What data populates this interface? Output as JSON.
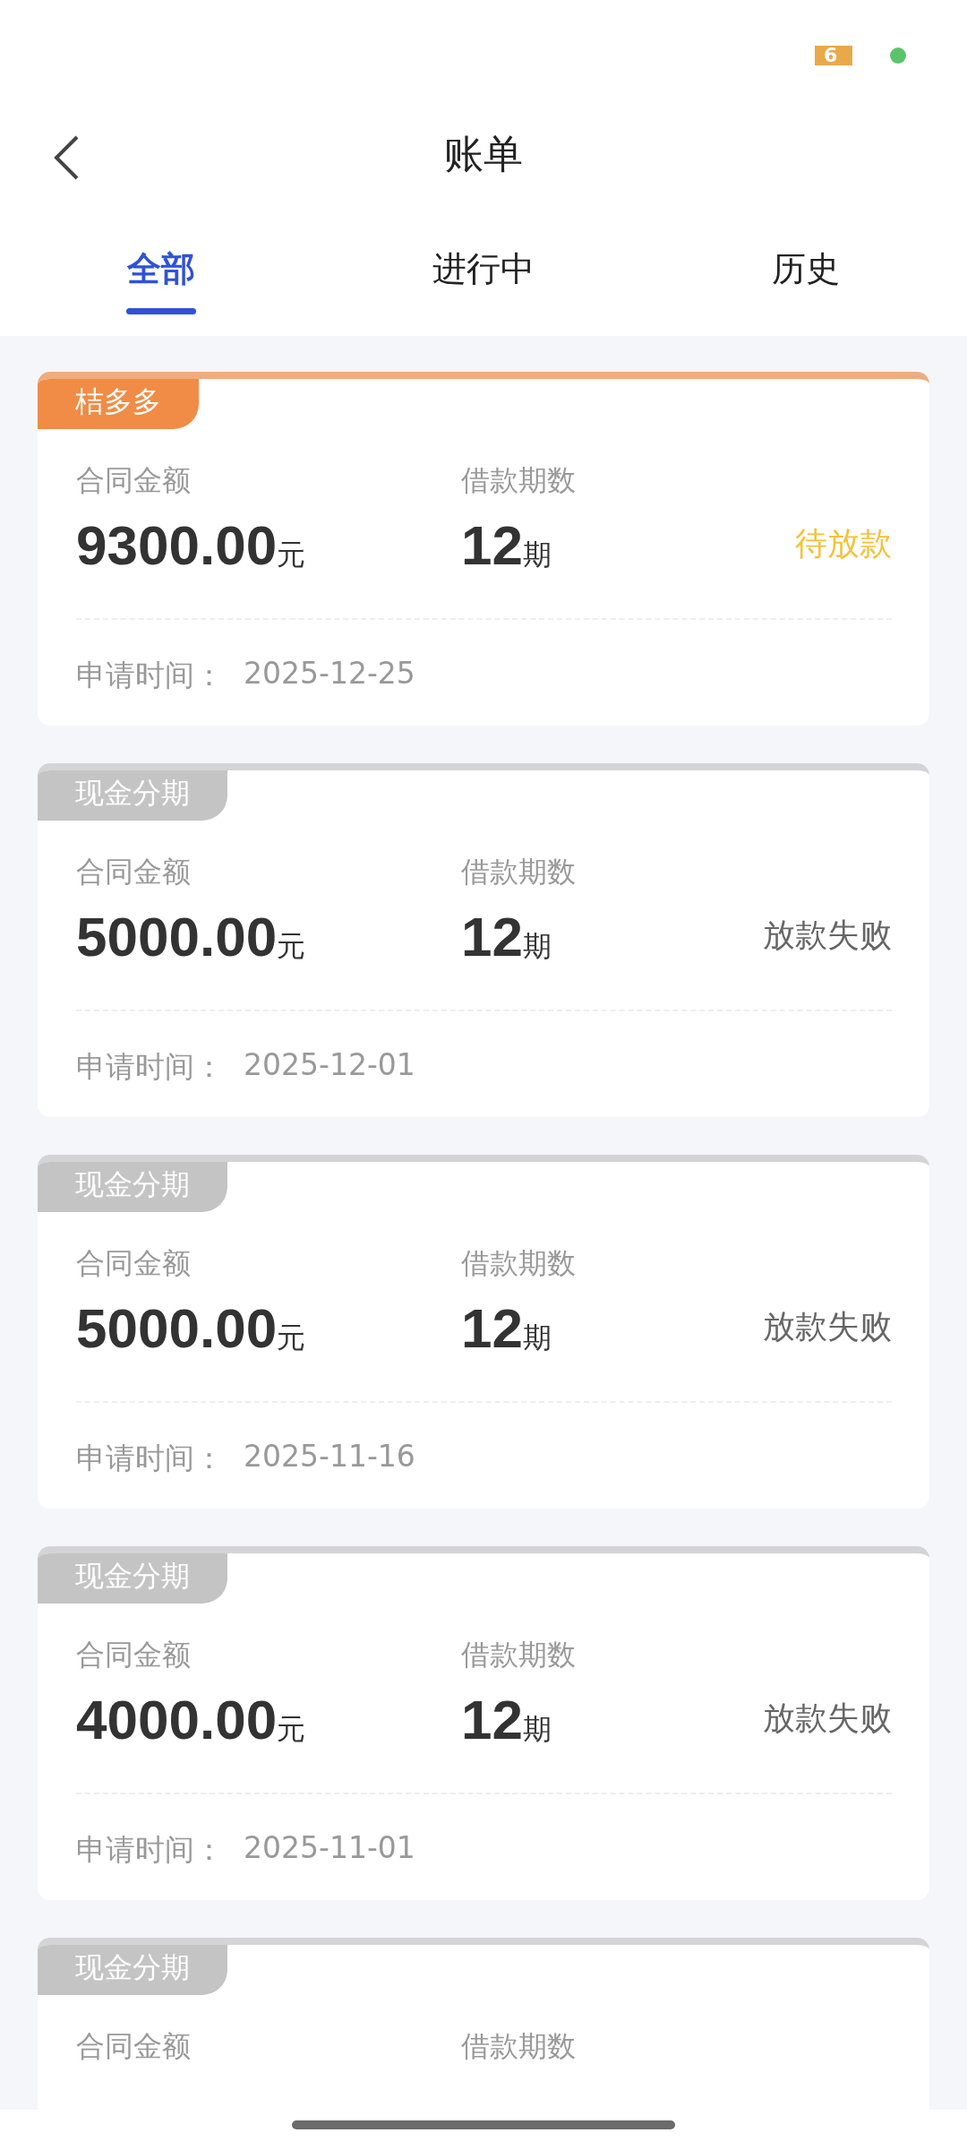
{
  "status_bar": {
    "battery": "6"
  },
  "header": {
    "title": "账单"
  },
  "tabs": [
    {
      "label": "全部",
      "selected": true
    },
    {
      "label": "进行中",
      "selected": false
    },
    {
      "label": "历史",
      "selected": false
    }
  ],
  "bills": [
    {
      "tag": "桔多多",
      "kind": "pending",
      "amount_label": "合同金额",
      "amount": "9300.00",
      "amount_unit": "元",
      "term_label": "借款期数",
      "term": "12",
      "term_unit": "期",
      "status": "待放款",
      "date_label": "申请时间：",
      "date": "2025-12-25"
    },
    {
      "tag": "现金分期",
      "kind": "failed",
      "amount_label": "合同金额",
      "amount": "5000.00",
      "amount_unit": "元",
      "term_label": "借款期数",
      "term": "12",
      "term_unit": "期",
      "status": "放款失败",
      "date_label": "申请时间：",
      "date": "2025-12-01"
    },
    {
      "tag": "现金分期",
      "kind": "failed",
      "amount_label": "合同金额",
      "amount": "5000.00",
      "amount_unit": "元",
      "term_label": "借款期数",
      "term": "12",
      "term_unit": "期",
      "status": "放款失败",
      "date_label": "申请时间：",
      "date": "2025-11-16"
    },
    {
      "tag": "现金分期",
      "kind": "failed",
      "amount_label": "合同金额",
      "amount": "4000.00",
      "amount_unit": "元",
      "term_label": "借款期数",
      "term": "12",
      "term_unit": "期",
      "status": "放款失败",
      "date_label": "申请时间：",
      "date": "2025-11-01"
    },
    {
      "tag": "现金分期",
      "kind": "failed",
      "amount_label": "合同金额",
      "term_label": "借款期数"
    }
  ]
}
